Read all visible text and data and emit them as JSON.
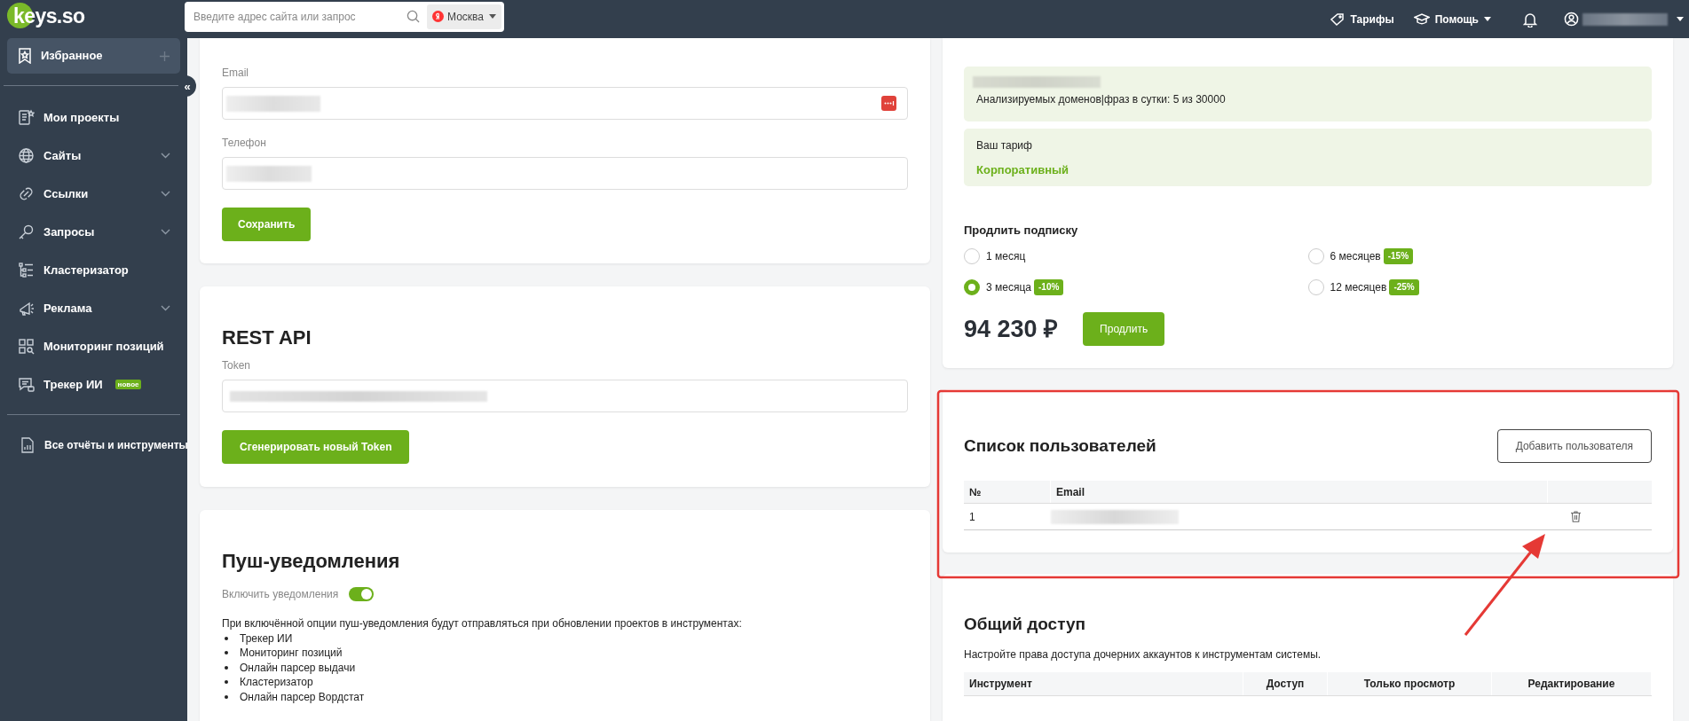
{
  "topbar": {
    "logo": "keys.so",
    "search": {
      "placeholder": "Введите адрес сайта или запрос"
    },
    "region": "Москва",
    "links": [
      {
        "label": "Тарифы",
        "kind": "tag",
        "dropdown": false
      },
      {
        "label": "Помощь",
        "kind": "help",
        "dropdown": true
      }
    ]
  },
  "sidebar": {
    "favorites": "Избранное",
    "collapse": "«",
    "items": [
      {
        "label": "Мои проекты",
        "expandable": false
      },
      {
        "label": "Сайты",
        "expandable": true
      },
      {
        "label": "Ссылки",
        "expandable": true
      },
      {
        "label": "Запросы",
        "expandable": true
      },
      {
        "label": "Кластеризатор",
        "expandable": false
      },
      {
        "label": "Реклама",
        "expandable": true
      },
      {
        "label": "Мониторинг позиций",
        "expandable": false
      },
      {
        "label": "Трекер ИИ",
        "expandable": false,
        "badge": "новое"
      }
    ],
    "footer": "Все отчёты и инструменты"
  },
  "profile_card": {
    "fields": [
      {
        "label": "Email",
        "kind": "email"
      },
      {
        "label": "Телефон",
        "kind": "phone"
      }
    ],
    "button": "Сохранить"
  },
  "api_card": {
    "title": "REST API",
    "field_label": "Token",
    "button": "Сгенерировать новый Token"
  },
  "push_card": {
    "title": "Пуш-уведомления",
    "toggle": {
      "label": "Включить уведомления",
      "on": true
    },
    "description": "При включённой опции пуш-уведомления будут отправляться при обновлении проектов в инструментах:",
    "tools": [
      "Трекер ИИ",
      "Мониторинг позиций",
      "Онлайн парсер выдачи",
      "Кластеризатор",
      "Онлайн парсер Вордстат"
    ]
  },
  "tariff_card": {
    "usage": "Анализируемых доменов|фраз в сутки: 5 из 30000",
    "plan_label": "Ваш тариф",
    "plan": "Корпоративный",
    "renew_title": "Продлить подписку",
    "periods": [
      {
        "label": "1 месяц",
        "selected": false
      },
      {
        "label": "3 месяца",
        "discount": "-10%",
        "selected": true
      },
      {
        "label": "6 месяцев",
        "discount": "-15%",
        "selected": false
      },
      {
        "label": "12 месяцев",
        "discount": "-25%",
        "selected": false
      }
    ],
    "price": "94 230 ₽",
    "button": "Продлить"
  },
  "users_card": {
    "title": "Список пользователей",
    "add_button": "Добавить пользователя",
    "columns": [
      "№",
      "Email"
    ],
    "rows": [
      {
        "number": "1"
      }
    ]
  },
  "access_card": {
    "title": "Общий доступ",
    "description": "Настройте права доступа дочерних аккаунтов к инструментам системы.",
    "columns": [
      "Инструмент",
      "Доступ",
      "Только просмотр",
      "Редактирование"
    ]
  }
}
